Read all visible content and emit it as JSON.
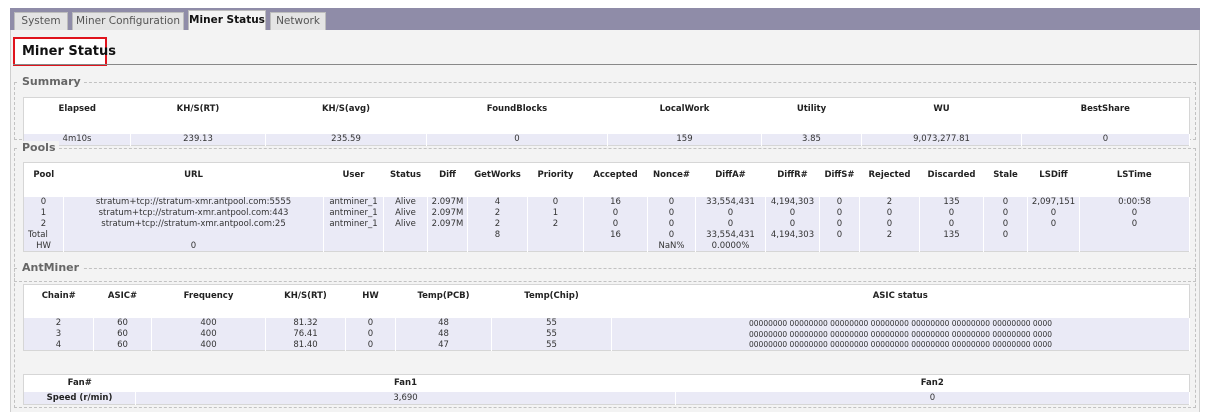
{
  "tabs": [
    {
      "label": "System"
    },
    {
      "label": "Miner Configuration"
    },
    {
      "label": "Miner Status"
    },
    {
      "label": "Network"
    }
  ],
  "page_title": "Miner Status",
  "summary": {
    "legend": "Summary",
    "headers": [
      "Elapsed",
      "KH/S(RT)",
      "KH/S(avg)",
      "FoundBlocks",
      "LocalWork",
      "Utility",
      "WU",
      "BestShare"
    ],
    "values": [
      "4m10s",
      "239.13",
      "235.59",
      "0",
      "159",
      "3.85",
      "9,073,277.81",
      "0"
    ]
  },
  "pools": {
    "legend": "Pools",
    "headers": [
      "Pool",
      "URL",
      "User",
      "Status",
      "Diff",
      "GetWorks",
      "Priority",
      "Accepted",
      "Nonce#",
      "DiffA#",
      "DiffR#",
      "DiffS#",
      "Rejected",
      "Discarded",
      "Stale",
      "LSDiff",
      "LSTime"
    ],
    "rows": [
      [
        "0",
        "stratum+tcp://stratum-xmr.antpool.com:5555",
        "antminer_1",
        "Alive",
        "2.097M",
        "4",
        "0",
        "16",
        "0",
        "33,554,431",
        "4,194,303",
        "0",
        "2",
        "135",
        "0",
        "2,097,151",
        "0:00:58"
      ],
      [
        "1",
        "stratum+tcp://stratum-xmr.antpool.com:443",
        "antminer_1",
        "Alive",
        "2.097M",
        "2",
        "1",
        "0",
        "0",
        "0",
        "0",
        "0",
        "0",
        "0",
        "0",
        "0",
        "0"
      ],
      [
        "2",
        "stratum+tcp://stratum-xmr.antpool.com:25",
        "antminer_1",
        "Alive",
        "2.097M",
        "2",
        "2",
        "0",
        "0",
        "0",
        "0",
        "0",
        "0",
        "0",
        "0",
        "0",
        "0"
      ],
      [
        "Total",
        "",
        "",
        "",
        "",
        "8",
        "",
        "16",
        "0",
        "33,554,431",
        "4,194,303",
        "0",
        "2",
        "135",
        "0",
        "",
        ""
      ],
      [
        "HW",
        "0",
        "",
        "",
        "",
        "",
        "",
        "",
        "NaN%",
        "0.0000%",
        "",
        "",
        "",
        "",
        "",
        "",
        ""
      ]
    ]
  },
  "antminer": {
    "legend": "AntMiner",
    "chain_headers": [
      "Chain#",
      "ASIC#",
      "Frequency",
      "KH/S(RT)",
      "HW",
      "Temp(PCB)",
      "Temp(Chip)",
      "ASIC status"
    ],
    "chains": [
      [
        "2",
        "60",
        "400",
        "81.32",
        "0",
        "48",
        "55",
        "00000000 00000000 00000000 00000000 00000000 00000000 00000000 0000"
      ],
      [
        "3",
        "60",
        "400",
        "76.41",
        "0",
        "48",
        "55",
        "00000000 00000000 00000000 00000000 00000000 00000000 00000000 0000"
      ],
      [
        "4",
        "60",
        "400",
        "81.40",
        "0",
        "47",
        "55",
        "00000000 00000000 00000000 00000000 00000000 00000000 00000000 0000"
      ]
    ],
    "fan_headers": [
      "Fan#",
      "Fan1",
      "Fan2"
    ],
    "fan_row": [
      "Speed (r/min)",
      "3,690",
      "0"
    ]
  }
}
